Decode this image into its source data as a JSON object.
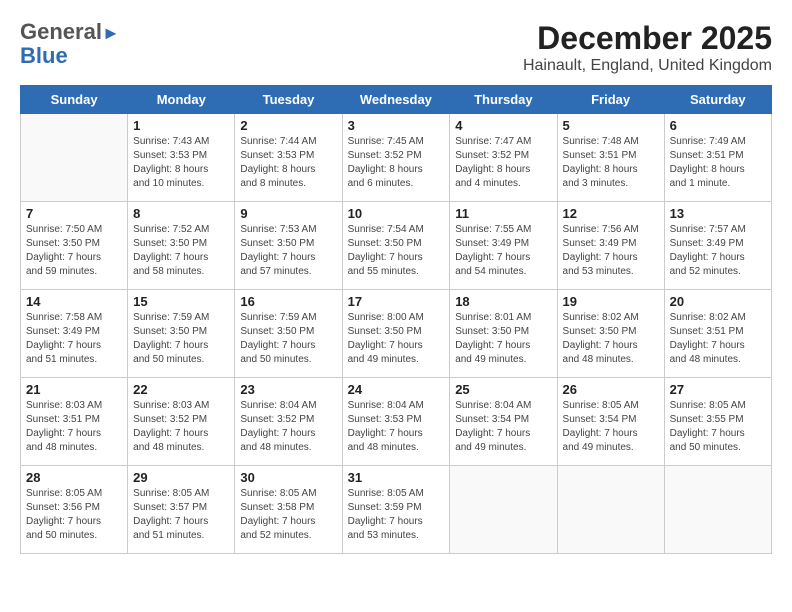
{
  "header": {
    "logo_line1": "General",
    "logo_line2": "Blue",
    "title": "December 2025",
    "subtitle": "Hainault, England, United Kingdom"
  },
  "columns": [
    "Sunday",
    "Monday",
    "Tuesday",
    "Wednesday",
    "Thursday",
    "Friday",
    "Saturday"
  ],
  "weeks": [
    [
      {
        "day": "",
        "info": ""
      },
      {
        "day": "1",
        "info": "Sunrise: 7:43 AM\nSunset: 3:53 PM\nDaylight: 8 hours\nand 10 minutes."
      },
      {
        "day": "2",
        "info": "Sunrise: 7:44 AM\nSunset: 3:53 PM\nDaylight: 8 hours\nand 8 minutes."
      },
      {
        "day": "3",
        "info": "Sunrise: 7:45 AM\nSunset: 3:52 PM\nDaylight: 8 hours\nand 6 minutes."
      },
      {
        "day": "4",
        "info": "Sunrise: 7:47 AM\nSunset: 3:52 PM\nDaylight: 8 hours\nand 4 minutes."
      },
      {
        "day": "5",
        "info": "Sunrise: 7:48 AM\nSunset: 3:51 PM\nDaylight: 8 hours\nand 3 minutes."
      },
      {
        "day": "6",
        "info": "Sunrise: 7:49 AM\nSunset: 3:51 PM\nDaylight: 8 hours\nand 1 minute."
      }
    ],
    [
      {
        "day": "7",
        "info": "Sunrise: 7:50 AM\nSunset: 3:50 PM\nDaylight: 7 hours\nand 59 minutes."
      },
      {
        "day": "8",
        "info": "Sunrise: 7:52 AM\nSunset: 3:50 PM\nDaylight: 7 hours\nand 58 minutes."
      },
      {
        "day": "9",
        "info": "Sunrise: 7:53 AM\nSunset: 3:50 PM\nDaylight: 7 hours\nand 57 minutes."
      },
      {
        "day": "10",
        "info": "Sunrise: 7:54 AM\nSunset: 3:50 PM\nDaylight: 7 hours\nand 55 minutes."
      },
      {
        "day": "11",
        "info": "Sunrise: 7:55 AM\nSunset: 3:49 PM\nDaylight: 7 hours\nand 54 minutes."
      },
      {
        "day": "12",
        "info": "Sunrise: 7:56 AM\nSunset: 3:49 PM\nDaylight: 7 hours\nand 53 minutes."
      },
      {
        "day": "13",
        "info": "Sunrise: 7:57 AM\nSunset: 3:49 PM\nDaylight: 7 hours\nand 52 minutes."
      }
    ],
    [
      {
        "day": "14",
        "info": "Sunrise: 7:58 AM\nSunset: 3:49 PM\nDaylight: 7 hours\nand 51 minutes."
      },
      {
        "day": "15",
        "info": "Sunrise: 7:59 AM\nSunset: 3:50 PM\nDaylight: 7 hours\nand 50 minutes."
      },
      {
        "day": "16",
        "info": "Sunrise: 7:59 AM\nSunset: 3:50 PM\nDaylight: 7 hours\nand 50 minutes."
      },
      {
        "day": "17",
        "info": "Sunrise: 8:00 AM\nSunset: 3:50 PM\nDaylight: 7 hours\nand 49 minutes."
      },
      {
        "day": "18",
        "info": "Sunrise: 8:01 AM\nSunset: 3:50 PM\nDaylight: 7 hours\nand 49 minutes."
      },
      {
        "day": "19",
        "info": "Sunrise: 8:02 AM\nSunset: 3:50 PM\nDaylight: 7 hours\nand 48 minutes."
      },
      {
        "day": "20",
        "info": "Sunrise: 8:02 AM\nSunset: 3:51 PM\nDaylight: 7 hours\nand 48 minutes."
      }
    ],
    [
      {
        "day": "21",
        "info": "Sunrise: 8:03 AM\nSunset: 3:51 PM\nDaylight: 7 hours\nand 48 minutes."
      },
      {
        "day": "22",
        "info": "Sunrise: 8:03 AM\nSunset: 3:52 PM\nDaylight: 7 hours\nand 48 minutes."
      },
      {
        "day": "23",
        "info": "Sunrise: 8:04 AM\nSunset: 3:52 PM\nDaylight: 7 hours\nand 48 minutes."
      },
      {
        "day": "24",
        "info": "Sunrise: 8:04 AM\nSunset: 3:53 PM\nDaylight: 7 hours\nand 48 minutes."
      },
      {
        "day": "25",
        "info": "Sunrise: 8:04 AM\nSunset: 3:54 PM\nDaylight: 7 hours\nand 49 minutes."
      },
      {
        "day": "26",
        "info": "Sunrise: 8:05 AM\nSunset: 3:54 PM\nDaylight: 7 hours\nand 49 minutes."
      },
      {
        "day": "27",
        "info": "Sunrise: 8:05 AM\nSunset: 3:55 PM\nDaylight: 7 hours\nand 50 minutes."
      }
    ],
    [
      {
        "day": "28",
        "info": "Sunrise: 8:05 AM\nSunset: 3:56 PM\nDaylight: 7 hours\nand 50 minutes."
      },
      {
        "day": "29",
        "info": "Sunrise: 8:05 AM\nSunset: 3:57 PM\nDaylight: 7 hours\nand 51 minutes."
      },
      {
        "day": "30",
        "info": "Sunrise: 8:05 AM\nSunset: 3:58 PM\nDaylight: 7 hours\nand 52 minutes."
      },
      {
        "day": "31",
        "info": "Sunrise: 8:05 AM\nSunset: 3:59 PM\nDaylight: 7 hours\nand 53 minutes."
      },
      {
        "day": "",
        "info": ""
      },
      {
        "day": "",
        "info": ""
      },
      {
        "day": "",
        "info": ""
      }
    ]
  ]
}
